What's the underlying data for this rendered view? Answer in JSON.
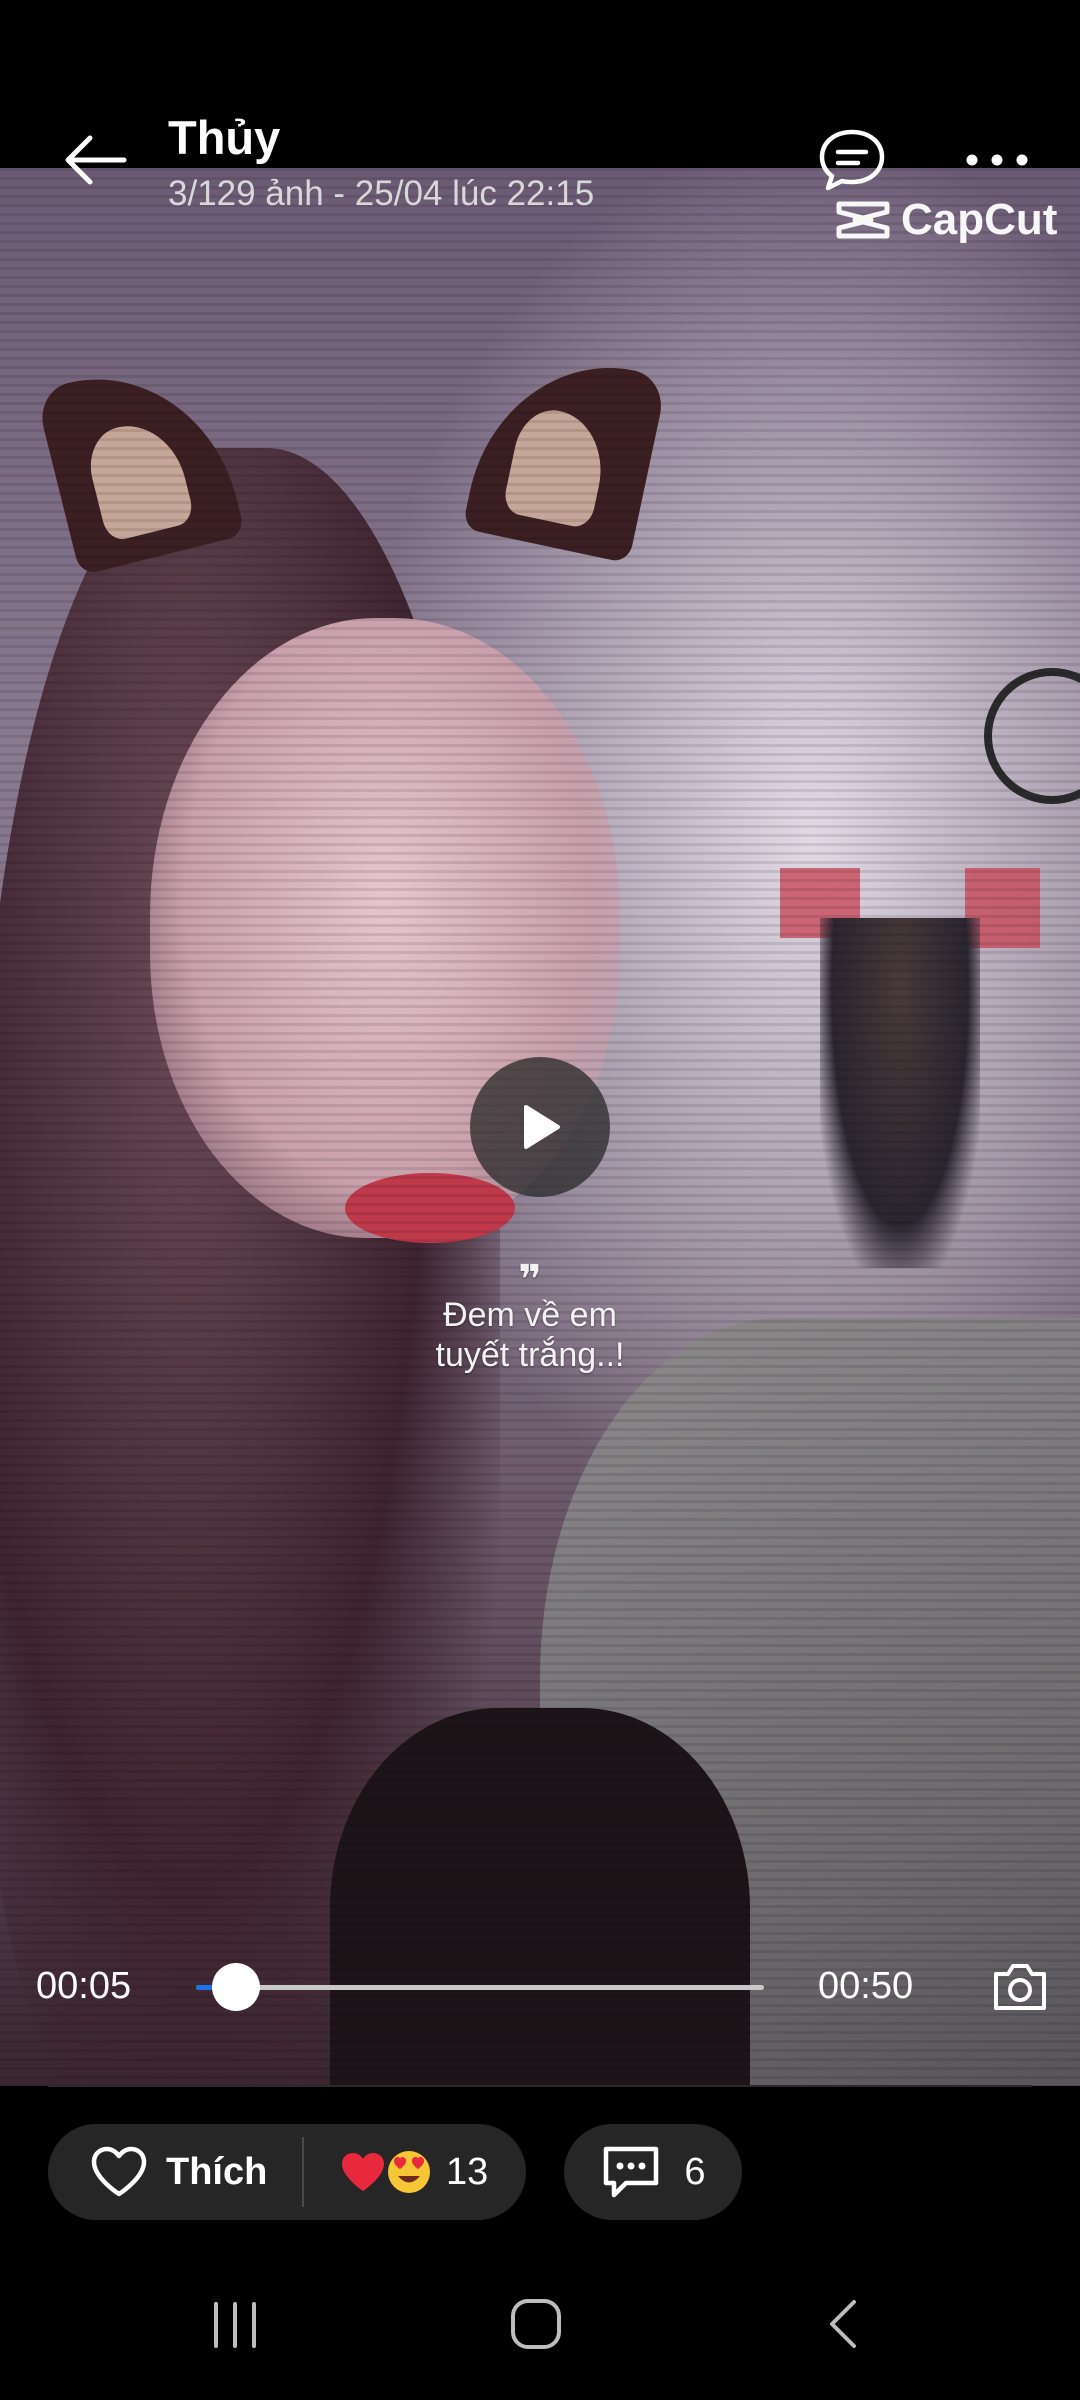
{
  "header": {
    "title": "Thủy",
    "subtitle": "3/129 ảnh - 25/04 lúc 22:15"
  },
  "watermark": {
    "text": "CapCut"
  },
  "video": {
    "caption_quote": "❞",
    "caption_line1": "Đem về em",
    "caption_line2": "tuyết trắng..!",
    "time_elapsed": "00:05",
    "time_total": "00:50",
    "progress": 0.07,
    "accent_color": "#1a73e8"
  },
  "actions": {
    "like_label": "Thích",
    "reaction_icons": [
      "heart-emoji",
      "heart-eyes-emoji"
    ],
    "reaction_count": "13",
    "comment_count": "6"
  },
  "icons": {
    "back": "arrow-left-icon",
    "chat": "chat-bubble-icon",
    "more": "more-dots-icon",
    "play": "play-icon",
    "camera": "camera-icon",
    "like": "heart-outline-icon",
    "comment": "comment-icon"
  }
}
